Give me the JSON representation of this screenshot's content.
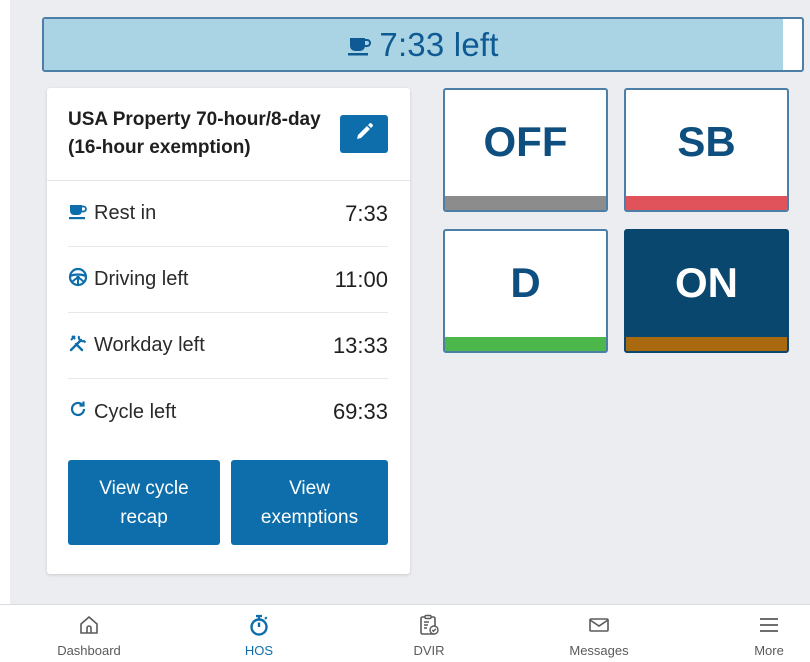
{
  "timer": {
    "label": "7:33 left",
    "icon": "coffee-cup-icon",
    "fill_fraction": 0.975
  },
  "ruleset": {
    "title": "USA Property 70-hour/8-day (16-hour exemption)",
    "edit_icon": "pencil-icon"
  },
  "clocks": [
    {
      "icon": "coffee-cup-icon",
      "label": "Rest in",
      "value": "7:33"
    },
    {
      "icon": "steering-wheel-icon",
      "label": "Driving left",
      "value": "11:00"
    },
    {
      "icon": "tools-icon",
      "label": "Workday left",
      "value": "13:33"
    },
    {
      "icon": "cycle-icon",
      "label": "Cycle left",
      "value": "69:33"
    }
  ],
  "actions": {
    "view_cycle_recap": "View cycle recap",
    "view_exemptions": "View exemptions"
  },
  "duty_status": {
    "off": {
      "label": "OFF",
      "color": "#8c8c8c"
    },
    "sb": {
      "label": "SB",
      "color": "#e0535a"
    },
    "d": {
      "label": "D",
      "color": "#4cb84c"
    },
    "on": {
      "label": "ON",
      "color": "#a9690f",
      "active": true
    }
  },
  "nav": {
    "dashboard": {
      "label": "Dashboard",
      "icon": "home-icon"
    },
    "hos": {
      "label": "HOS",
      "icon": "stopwatch-icon",
      "active": true
    },
    "dvir": {
      "label": "DVIR",
      "icon": "clipboard-check-icon"
    },
    "messages": {
      "label": "Messages",
      "icon": "envelope-icon"
    },
    "more": {
      "label": "More",
      "icon": "menu-icon"
    }
  },
  "colors": {
    "primary": "#0d6eab",
    "active_tile": "#0a476f",
    "timer_fill": "#aad3e3",
    "background": "#ecedf0"
  }
}
